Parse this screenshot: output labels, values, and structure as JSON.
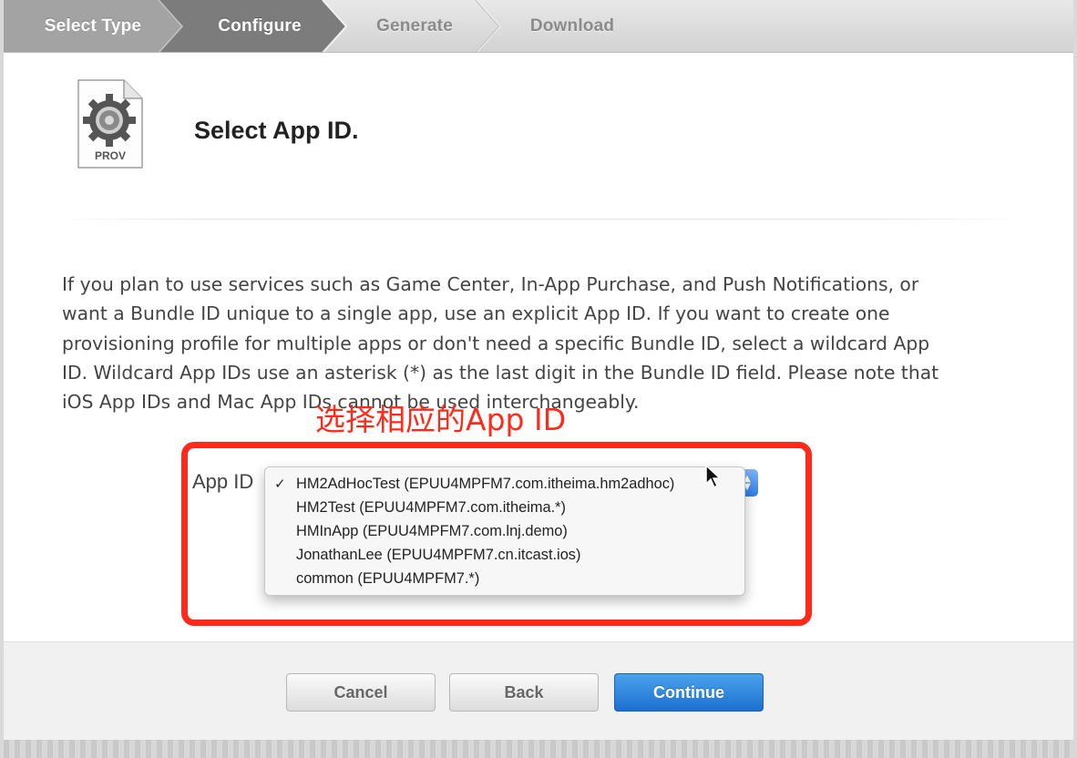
{
  "steps": [
    {
      "label": "Select Type",
      "state": "done"
    },
    {
      "label": "Configure",
      "state": "active"
    },
    {
      "label": "Generate",
      "state": "todo"
    },
    {
      "label": "Download",
      "state": "todo"
    }
  ],
  "header": {
    "icon_label": "PROV",
    "title": "Select App ID."
  },
  "description": "If you plan to use services such as Game Center, In-App Purchase, and Push Notifications, or want a Bundle ID unique to a single app, use an explicit App ID. If you want to create one provisioning profile for multiple apps or don't need a specific Bundle ID, select a wildcard App ID. Wildcard App IDs use an asterisk (*) as the last digit in the Bundle ID field. Please note that iOS App IDs and Mac App IDs cannot be used interchangeably.",
  "annotation": "选择相应的App ID",
  "app_id_field": {
    "label": "App ID",
    "selected_index": 0,
    "options": [
      "HM2AdHocTest (EPUU4MPFM7.com.itheima.hm2adhoc)",
      "HM2Test (EPUU4MPFM7.com.itheima.*)",
      "HMInApp (EPUU4MPFM7.com.lnj.demo)",
      "JonathanLee (EPUU4MPFM7.cn.itcast.ios)",
      "common (EPUU4MPFM7.*)"
    ]
  },
  "footer": {
    "cancel_label": "Cancel",
    "back_label": "Back",
    "continue_label": "Continue"
  },
  "colors": {
    "annotation_red": "#ff2a1a",
    "step_active": "#7a7a7a",
    "step_done": "#9a9a9a",
    "primary_button": "#2a83dc"
  }
}
